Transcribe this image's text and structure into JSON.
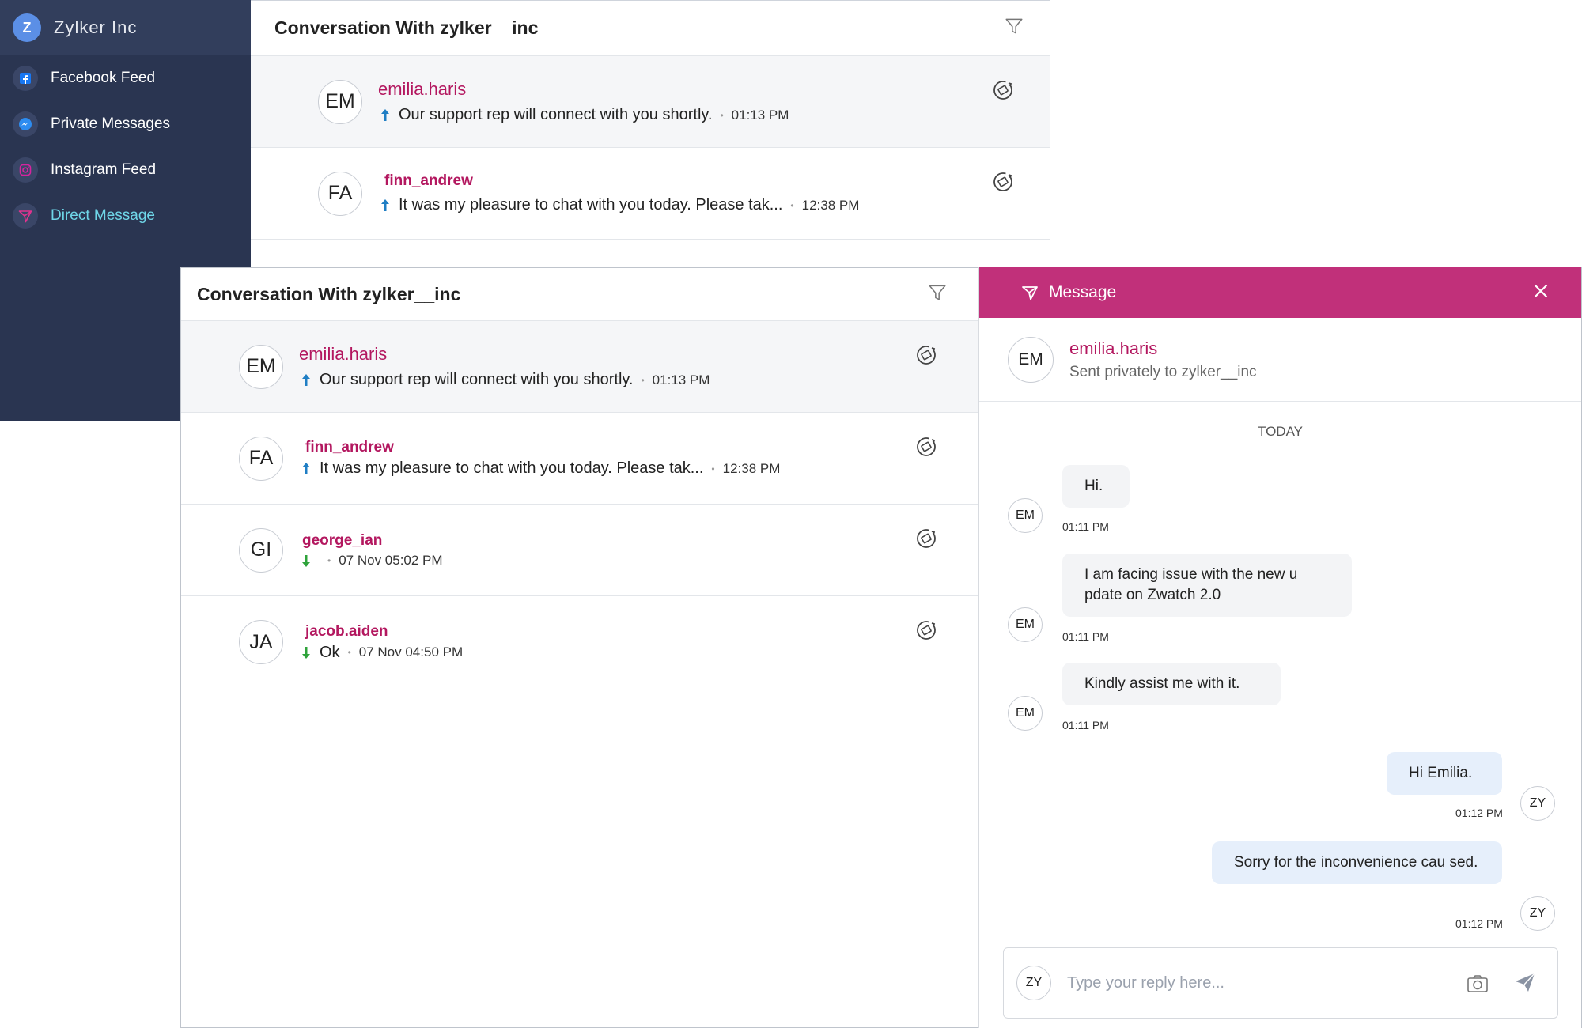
{
  "sidebar": {
    "brand": {
      "logo": "Z",
      "name": "Zylker Inc"
    },
    "items": [
      {
        "label": "Facebook Feed",
        "icon": "facebook-icon",
        "color": "#1877f2"
      },
      {
        "label": "Private Messages",
        "icon": "messenger-icon",
        "color": "#2d8cf0"
      },
      {
        "label": "Instagram Feed",
        "icon": "instagram-icon",
        "color": "#d6249f"
      },
      {
        "label": "Direct Message",
        "icon": "direct-message-icon",
        "color": "#e0338f"
      }
    ]
  },
  "back_list": {
    "title": "Conversation With zylker__inc",
    "rows": [
      {
        "initials": "EM",
        "name": "emilia.haris",
        "preview": "Our support rep will connect with you shortly.",
        "time": "01:13 PM"
      },
      {
        "initials": "FA",
        "name": "finn_andrew",
        "preview": "It was my pleasure to chat with you today. Please tak...",
        "time": "12:38 PM"
      }
    ]
  },
  "front_list": {
    "title": "Conversation With zylker__inc",
    "rows": [
      {
        "initials": "EM",
        "name": "emilia.haris",
        "preview": "Our support rep will connect with you shortly.",
        "time": "01:13 PM"
      },
      {
        "initials": "FA",
        "name": "finn_andrew",
        "preview": "It was my pleasure to chat with you today. Please tak...",
        "time": "12:38 PM"
      },
      {
        "initials": "GI",
        "name": "george_ian",
        "preview": "",
        "time": "07 Nov 05:02 PM"
      },
      {
        "initials": "JA",
        "name": "jacob.aiden",
        "preview": "Ok",
        "time": "07 Nov 04:50 PM"
      }
    ]
  },
  "message_panel": {
    "header": "Message",
    "contact": {
      "initials": "EM",
      "name": "emilia.haris",
      "subtitle": "Sent privately to zylker__inc"
    },
    "day_label": "TODAY",
    "messages": [
      {
        "from": "EM",
        "text": "Hi.",
        "time": "01:11 PM"
      },
      {
        "from": "EM",
        "text": "I am facing issue with the new u pdate on Zwatch 2.0",
        "time": "01:11 PM"
      },
      {
        "from": "EM",
        "text": "Kindly assist me with it.",
        "time": "01:11 PM"
      },
      {
        "from": "ZY",
        "text": "Hi Emilia.",
        "time": "01:12 PM"
      },
      {
        "from": "ZY",
        "text": "Sorry for the inconvenience cau sed.",
        "time": "01:12 PM"
      }
    ],
    "composer": {
      "initials": "ZY",
      "placeholder": "Type your reply here..."
    }
  },
  "colors": {
    "accent": "#c1307a",
    "sidebar_bg": "#2a3551",
    "name_text": "#b3175f",
    "outgoing_arrow": "#1f7ec4",
    "incoming_arrow": "#2fa33b"
  }
}
